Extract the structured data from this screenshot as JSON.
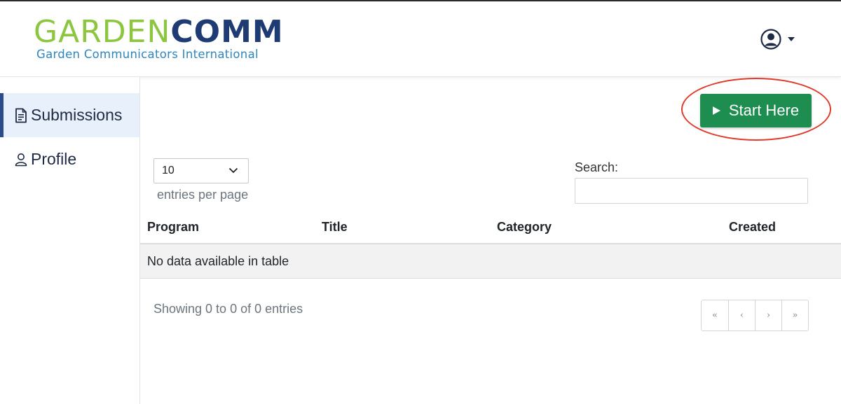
{
  "header": {
    "logo_garden": "GARDEN",
    "logo_comm": "COMM",
    "logo_sub": "Garden Communicators International",
    "user_icon": "user-circle-icon"
  },
  "sidebar": {
    "items": [
      {
        "label": "Submissions",
        "icon": "document-icon",
        "active": true
      },
      {
        "label": "Profile",
        "icon": "person-icon",
        "active": false
      }
    ]
  },
  "toolbar": {
    "start_label": "Start Here",
    "start_icon": "play-icon"
  },
  "table_controls": {
    "entries_value": "10",
    "entries_label": "entries per page",
    "search_label": "Search:",
    "search_value": "",
    "search_placeholder": ""
  },
  "table": {
    "columns": [
      "Program",
      "Title",
      "Category",
      "Created"
    ],
    "empty_message": "No data available in table",
    "info": "Showing 0 to 0 of 0 entries"
  },
  "pagination": {
    "first": "«",
    "prev": "‹",
    "next": "›",
    "last": "»"
  },
  "colors": {
    "brand_green": "#8cc63f",
    "brand_navy": "#1f3b73",
    "brand_blue": "#2e86c1",
    "button_green": "#1e8e50",
    "annotation_red": "#e03a2a",
    "active_nav_bg": "#e8f0fb"
  }
}
